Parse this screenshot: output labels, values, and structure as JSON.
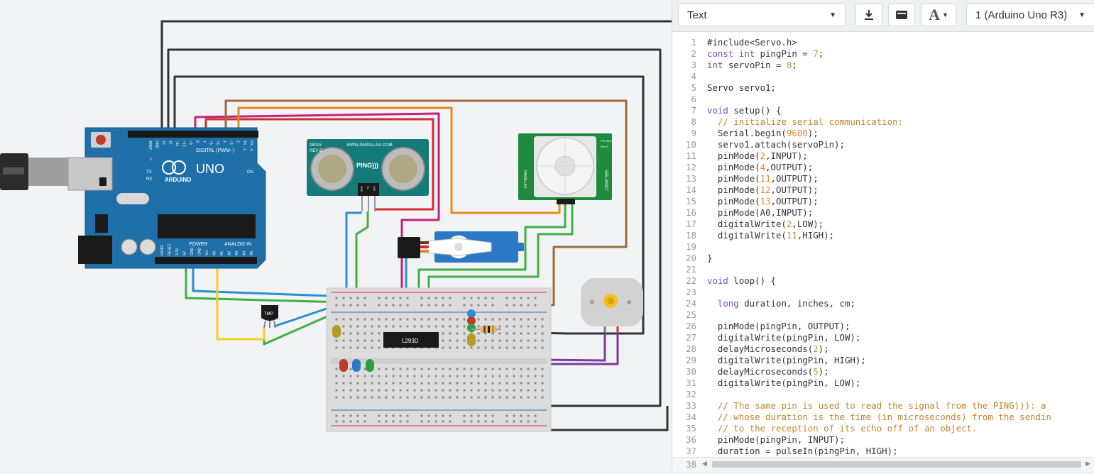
{
  "toolbar": {
    "mode_label": "Text",
    "board_label": "1 (Arduino Uno R3)",
    "download_icon": "download-icon",
    "library_icon": "library-icon",
    "font_size_icon": "font-size-icon"
  },
  "code_lines": [
    "#include<Servo.h>",
    "const int pingPin = 7;",
    "int servoPin = 8;",
    "",
    "Servo servo1;",
    "",
    "void setup() {",
    "  // initialize serial communication:",
    "  Serial.begin(9600);",
    "  servo1.attach(servoPin);",
    "  pinMode(2,INPUT);",
    "  pinMode(4,OUTPUT);",
    "  pinMode(11,OUTPUT);",
    "  pinMode(12,OUTPUT);",
    "  pinMode(13,OUTPUT);",
    "  pinMode(A0,INPUT);",
    "  digitalWrite(2,LOW);",
    "  digitalWrite(11,HIGH);",
    "",
    "}",
    "",
    "void loop() {",
    "",
    "  long duration, inches, cm;",
    "",
    "  pinMode(pingPin, OUTPUT);",
    "  digitalWrite(pingPin, LOW);",
    "  delayMicroseconds(2);",
    "  digitalWrite(pingPin, HIGH);",
    "  delayMicroseconds(5);",
    "  digitalWrite(pingPin, LOW);",
    "",
    "  // The same pin is used to read the signal from the PING))): a",
    "  // whose duration is the time (in microseconds) from the sendin",
    "  // to the reception of its echo off of an object.",
    "  pinMode(pingPin, INPUT);",
    "  duration = pulseIn(pingPin, HIGH);"
  ],
  "last_line_number": "38",
  "circuit": {
    "arduino": {
      "brand": "ARDUINO",
      "model": "UNO",
      "digital_label": "DIGITAL (PWM~)",
      "power_label": "POWER",
      "analog_label": "ANALOG IN",
      "pin_labels_top": [
        "AREF",
        "GND",
        "13",
        "12",
        "~11",
        "~10",
        "~9",
        "8",
        "7",
        "~6",
        "~5",
        "4",
        "~3",
        "2",
        "TX→1",
        "RX←0"
      ],
      "pin_labels_bottom": [
        "IOREF",
        "RESET",
        "3.3V",
        "5V",
        "GND",
        "GND",
        "Vin",
        "A0",
        "A1",
        "A2",
        "A3",
        "A4",
        "A5"
      ],
      "led_labels": [
        "L",
        "TX",
        "RX",
        "ON"
      ]
    },
    "ping_sensor": {
      "brand": "WWW.PARALLAX.COM",
      "label": "PING)))",
      "part": "28015",
      "rev": "REV C",
      "pins": [
        "GND",
        "5V",
        "SIG"
      ]
    },
    "pir_sensor": {
      "title": "PIR Sensor",
      "rev": "Rev B",
      "part": "555-28027",
      "brand": "PARALLAX"
    },
    "temp_sensor_label": "TMP",
    "driver_chip_label": "L293D",
    "colors": {
      "arduino_board": "#1f6fa8",
      "breadboard": "#dcdcdc",
      "wire_black": "#333333",
      "wire_red": "#d32f2f",
      "wire_magenta": "#c2237e",
      "wire_orange": "#e8891c",
      "wire_brown": "#9b6a3c",
      "wire_blue": "#2a8fd0",
      "wire_green": "#3cb043",
      "wire_yellow": "#f0d020",
      "wire_purple": "#7a3b9e"
    }
  }
}
